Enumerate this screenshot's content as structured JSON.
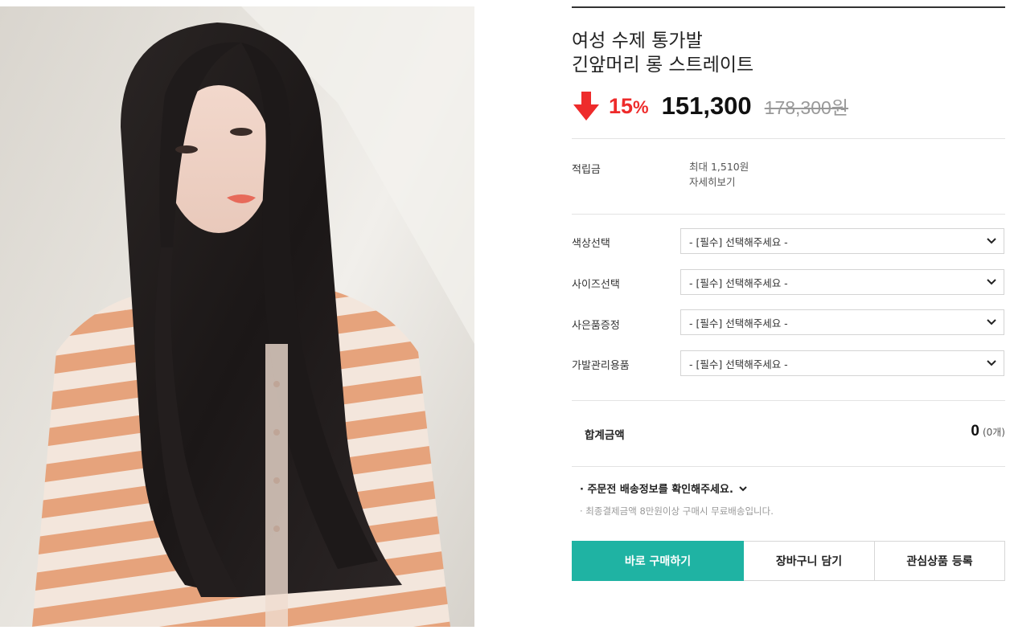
{
  "product": {
    "image_alt": "long straight hair wig model photo",
    "title_line1": "여성 수제 통가발",
    "title_line2": "긴앞머리 롱 스트레이트"
  },
  "price": {
    "discount": "15",
    "percent_sign": "%",
    "sale_price": "151,300",
    "original_price": "178,300원",
    "discount_color": "#ee2b2b",
    "arrow_icon": "arrow-down-icon"
  },
  "reward": {
    "label": "적립금",
    "value": "최대 1,510원",
    "link": "자세히보기"
  },
  "options": [
    {
      "label": "색상선택",
      "selected": "- [필수] 선택해주세요 -"
    },
    {
      "label": "사이즈선택",
      "selected": "- [필수] 선택해주세요 -"
    },
    {
      "label": "사은품증정",
      "selected": "- [필수] 선택해주세요 -"
    },
    {
      "label": "가발관리용품",
      "selected": "- [필수] 선택해주세요 -"
    }
  ],
  "total": {
    "label": "합계금액",
    "amount": "0",
    "count": "(0개)"
  },
  "shipping": {
    "notice": "· 주문전 배송정보를 확인해주세요.",
    "sub": "· 최종결제금액 8만원이상 구매시 무료배송입니다."
  },
  "buttons": {
    "buy": "바로 구매하기",
    "cart": "장바구니 담기",
    "wish": "관심상품 등록",
    "buy_color": "#1fb3a3"
  }
}
